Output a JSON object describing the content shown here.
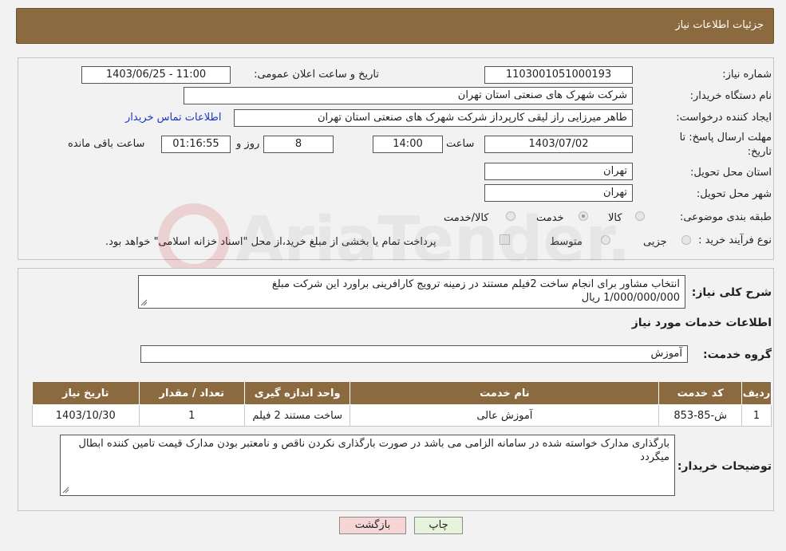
{
  "header": {
    "title": "جزئیات اطلاعات نیاز"
  },
  "form": {
    "need_number_label": "شماره نیاز:",
    "need_number": "1103001051000193",
    "announce_label": "تاریخ و ساعت اعلان عمومی:",
    "announce_value": "1403/06/25 - 11:00",
    "buyer_label": "نام دستگاه خریدار:",
    "buyer_value": "شرکت شهرک های صنعتی استان تهران",
    "creator_label": "ایجاد کننده درخواست:",
    "creator_value": "طاهر  میرزایی راز لیقی کارپرداز شرکت شهرک های صنعتی استان تهران",
    "contact_link": "اطلاعات تماس خریدار",
    "deadline_label_1": "مهلت ارسال پاسخ: تا",
    "deadline_label_2": "تاریخ:",
    "deadline_date": "1403/07/02",
    "time_label": "ساعت",
    "deadline_time": "14:00",
    "days_value": "8",
    "days_label": "روز و",
    "remaining_value": "01:16:55",
    "remaining_label": "ساعت باقی مانده",
    "province_label": "استان محل تحویل:",
    "province_value": "تهران",
    "city_label": "شهر محل تحویل:",
    "city_value": "تهران",
    "category_label": "طبقه بندی موضوعی:",
    "category_options": [
      "کالا",
      "خدمت",
      "کالا/خدمت"
    ],
    "category_selected": "خدمت",
    "purchase_label": "نوع فرآیند خرید :",
    "purchase_options": [
      "جزیی",
      "متوسط"
    ],
    "purchase_note": "پرداخت تمام یا بخشی از مبلغ خرید،از محل \"اسناد خزانه اسلامی\" خواهد بود."
  },
  "description": {
    "label": "شرح کلی نیاز:",
    "line1": "انتخاب مشاور برای انجام ساخت 2فیلم مستند در زمینه ترویج کارافرینی  براورد این شرکت مبلغ",
    "line2": "1/000/000/000 ریال"
  },
  "services": {
    "section_title": "اطلاعات خدمات مورد نیاز",
    "group_label": "گروه خدمت:",
    "group_value": "آموزش",
    "columns": [
      "ردیف",
      "کد خدمت",
      "نام خدمت",
      "واحد اندازه گیری",
      "تعداد / مقدار",
      "تاریخ نیاز"
    ],
    "rows": [
      {
        "row": "1",
        "code": "ش-85-853",
        "name": "آموزش عالی",
        "unit": "ساخت مستند 2 فیلم",
        "qty": "1",
        "date": "1403/10/30"
      }
    ]
  },
  "buyer_notes": {
    "label": "توضیحات خریدار:",
    "text": "بارگذاری مدارک خواسته شده در سامانه الزامی می باشد در صورت بارگذاری نکردن ناقص و نامعتبر بودن مدارک قیمت تامین کننده ابطال میگردد"
  },
  "buttons": {
    "print": "چاپ",
    "back": "بازگشت"
  },
  "watermark": {
    "brand": "AriaTender.net"
  },
  "colors": {
    "header": "#8c6a3f",
    "back_button": "#f6d5d5",
    "print_button": "#e6f4dc",
    "link": "#1a35c9"
  }
}
